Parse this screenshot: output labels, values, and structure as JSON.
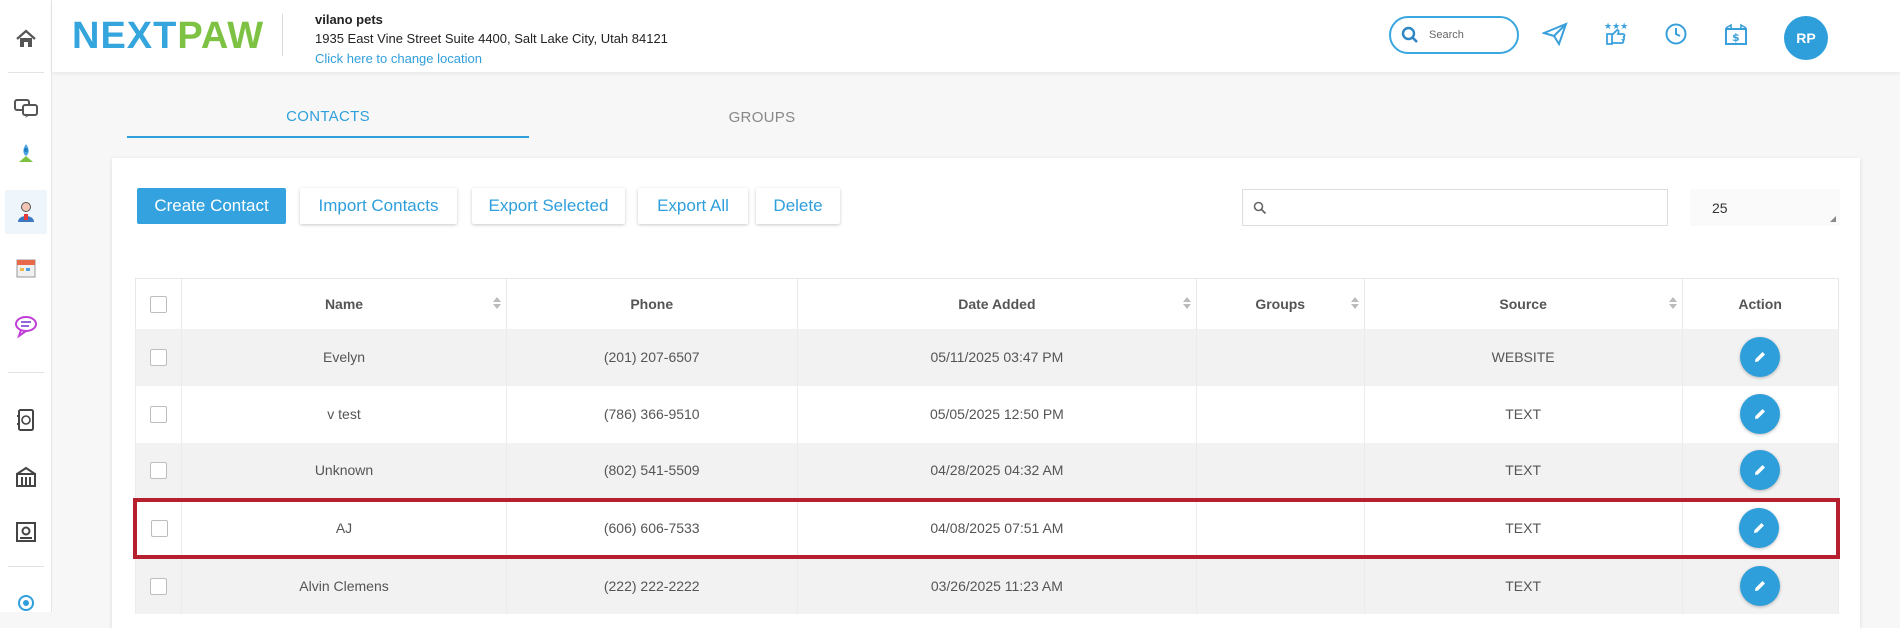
{
  "brand": {
    "logo_next": "NEXT",
    "logo_paw": "PAW",
    "accent": "#35a5dd",
    "green": "#7dc242"
  },
  "location": {
    "name": "vilano pets",
    "address": "1935 East Vine Street Suite 4400, Salt Lake City, Utah 84121",
    "change_link": "Click here to change location"
  },
  "header": {
    "search_placeholder": "Search",
    "avatar_initials": "RP",
    "icons": [
      "paper-plane-icon",
      "review-stars-icon",
      "clock-icon",
      "money-gift-icon"
    ]
  },
  "sidebar": {
    "icons": [
      "home-icon",
      "chat-bubbles-icon",
      "campaign-icon",
      "contacts-icon",
      "calendar-icon",
      "message-icon",
      "payments-icon",
      "building-icon",
      "settings-icon",
      "award-icon"
    ]
  },
  "tabs": [
    {
      "label": "CONTACTS",
      "active": true
    },
    {
      "label": "GROUPS",
      "active": false
    }
  ],
  "toolbar": {
    "create_label": "Create Contact",
    "import_label": "Import Contacts",
    "export_selected_label": "Export Selected",
    "export_all_label": "Export All",
    "delete_label": "Delete",
    "search_value": "",
    "per_page": "25"
  },
  "table": {
    "columns": [
      "Name",
      "Phone",
      "Date Added",
      "Groups",
      "Source",
      "Action"
    ],
    "rows": [
      {
        "name": "Evelyn",
        "phone": "(201) 207-6507",
        "date": "05/11/2025 03:47 PM",
        "groups": "",
        "source": "WEBSITE"
      },
      {
        "name": "v test",
        "phone": "(786) 366-9510",
        "date": "05/05/2025 12:50 PM",
        "groups": "",
        "source": "TEXT"
      },
      {
        "name": "Unknown",
        "phone": "(802) 541-5509",
        "date": "04/28/2025 04:32 AM",
        "groups": "",
        "source": "TEXT"
      },
      {
        "name": "AJ",
        "phone": "(606) 606-7533",
        "date": "04/08/2025 07:51 AM",
        "groups": "",
        "source": "TEXT",
        "highlighted": true
      },
      {
        "name": "Alvin Clemens",
        "phone": "(222) 222-2222",
        "date": "03/26/2025 11:23 AM",
        "groups": "",
        "source": "TEXT"
      }
    ]
  }
}
